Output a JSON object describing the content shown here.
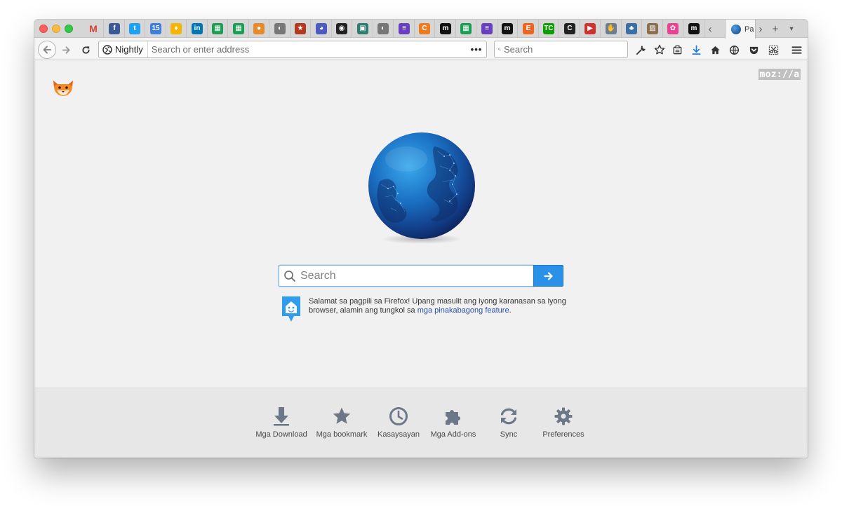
{
  "browser": {
    "active_tab_title": "Pa",
    "identity_label": "Nightly",
    "url_placeholder": "Search or enter address",
    "search_placeholder": "Search",
    "page_action_label": "•••"
  },
  "pinned_tabs": [
    {
      "name": "gmail",
      "label": "M",
      "color": "#d44638",
      "text_color": "#d44638",
      "bg": "transparent"
    },
    {
      "name": "facebook",
      "label": "f",
      "bg": "#3b5998"
    },
    {
      "name": "twitter",
      "label": "t",
      "bg": "#1da1f2"
    },
    {
      "name": "calendar",
      "label": "15",
      "bg": "#3d7de0"
    },
    {
      "name": "keep",
      "label": "♦",
      "bg": "#f4b400"
    },
    {
      "name": "linkedin",
      "label": "in",
      "bg": "#0077b5"
    },
    {
      "name": "sheets",
      "label": "▦",
      "bg": "#1e9e55"
    },
    {
      "name": "sheets-2",
      "label": "▦",
      "bg": "#1e9e55"
    },
    {
      "name": "basketball",
      "label": "●",
      "bg": "#e68a2e"
    },
    {
      "name": "globe",
      "label": "◐",
      "bg": "#777777"
    },
    {
      "name": "star",
      "label": "★",
      "bg": "#b23a1e"
    },
    {
      "name": "monitor",
      "label": "◕",
      "bg": "#4a5cc0"
    },
    {
      "name": "github",
      "label": "◉",
      "bg": "#222222"
    },
    {
      "name": "contact",
      "label": "▣",
      "bg": "#2f7d6e"
    },
    {
      "name": "globe-2",
      "label": "◐",
      "bg": "#777777"
    },
    {
      "name": "forms",
      "label": "≡",
      "bg": "#6a3fbf"
    },
    {
      "name": "c-app",
      "label": "C",
      "bg": "#f07b1c"
    },
    {
      "name": "medium",
      "label": "m",
      "bg": "#111111"
    },
    {
      "name": "sheets-3",
      "label": "▦",
      "bg": "#1e9e55"
    },
    {
      "name": "forms-2",
      "label": "≡",
      "bg": "#6a3fbf"
    },
    {
      "name": "medium-2",
      "label": "m",
      "bg": "#111111"
    },
    {
      "name": "etsy",
      "label": "E",
      "bg": "#f1641e"
    },
    {
      "name": "techcrunch",
      "label": "TC",
      "bg": "#0a9e01"
    },
    {
      "name": "c-circle",
      "label": "C",
      "bg": "#222222"
    },
    {
      "name": "video",
      "label": "▶",
      "bg": "#d0312d"
    },
    {
      "name": "hand",
      "label": "✋",
      "bg": "#6b7c93"
    },
    {
      "name": "people",
      "label": "♣",
      "bg": "#3a6ea5"
    },
    {
      "name": "photo",
      "label": "▨",
      "bg": "#8b6e4e"
    },
    {
      "name": "photos",
      "label": "✿",
      "bg": "#e84393"
    },
    {
      "name": "medium-3",
      "label": "m",
      "bg": "#111111"
    }
  ],
  "tab_controls": {
    "scroll_left": "‹",
    "scroll_right": "›",
    "new_tab": "+",
    "list_all": "▾"
  },
  "home": {
    "logo_text": "moz://a",
    "search_placeholder": "Search",
    "snippet_text": "Salamat sa pagpili sa Firefox! Upang masulit ang iyong karanasan sa iyong browser, alamin ang tungkol sa ",
    "snippet_link": "mga pinakabagong feature",
    "snippet_end": "."
  },
  "launcher": [
    {
      "label": "Mga Download",
      "icon": "download-icon"
    },
    {
      "label": "Mga bookmark",
      "icon": "star-icon"
    },
    {
      "label": "Kasaysayan",
      "icon": "clock-icon"
    },
    {
      "label": "Mga Add-ons",
      "icon": "puzzle-icon"
    },
    {
      "label": "Sync",
      "icon": "sync-icon"
    },
    {
      "label": "Preferences",
      "icon": "gear-icon"
    }
  ],
  "colors": {
    "accent": "#2a90e8",
    "launcher_icon": "#6c7888"
  }
}
